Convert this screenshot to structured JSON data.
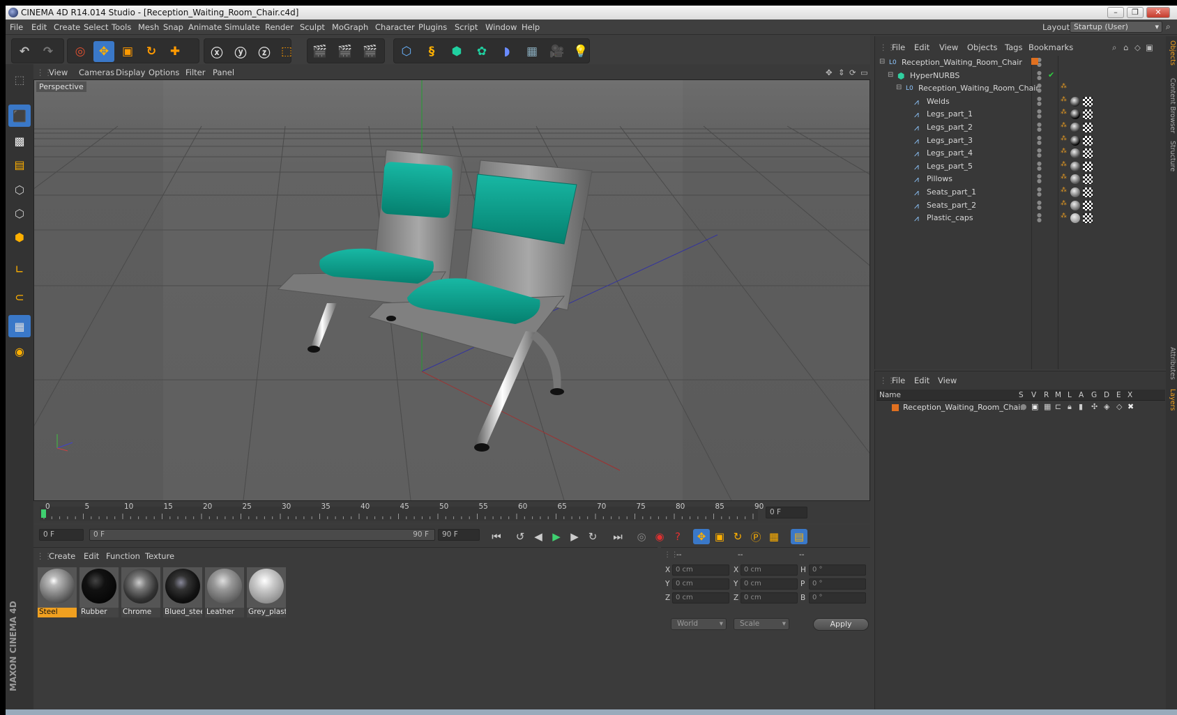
{
  "title": "CINEMA 4D R14.014 Studio - [Reception_Waiting_Room_Chair.c4d]",
  "menus": [
    "File",
    "Edit",
    "Create",
    "Select",
    "Tools",
    "Mesh",
    "Snap",
    "Animate",
    "Simulate",
    "Render",
    "Sculpt",
    "MoGraph",
    "Character",
    "Plugins",
    "Script",
    "Window",
    "Help"
  ],
  "layout": {
    "label": "Layout:",
    "value": "Startup (User)"
  },
  "viewport": {
    "menus": [
      "View",
      "Cameras",
      "Display",
      "Options",
      "Filter",
      "Panel"
    ],
    "label": "Perspective"
  },
  "timeline": {
    "ticks": [
      "0",
      "5",
      "10",
      "15",
      "20",
      "25",
      "30",
      "35",
      "40",
      "45",
      "50",
      "55",
      "60",
      "65",
      "70",
      "75",
      "80",
      "85",
      "90"
    ],
    "current_frame": "0 F",
    "start_field": "0 F",
    "range_start": "0 F",
    "range_end": "90 F",
    "end_field": "90 F"
  },
  "materials": {
    "menus": [
      "Create",
      "Edit",
      "Function",
      "Texture"
    ],
    "items": [
      {
        "name": "Steel",
        "selected": true
      },
      {
        "name": "Rubber"
      },
      {
        "name": "Chrome"
      },
      {
        "name": "Blued_stee"
      },
      {
        "name": "Leather"
      },
      {
        "name": "Grey_plasti"
      }
    ]
  },
  "coordinates": {
    "headers": [
      "--",
      "--",
      "--"
    ],
    "rows": [
      {
        "l1": "X",
        "v1": "0 cm",
        "l2": "X",
        "v2": "0 cm",
        "l3": "H",
        "v3": "0 °"
      },
      {
        "l1": "Y",
        "v1": "0 cm",
        "l2": "Y",
        "v2": "0 cm",
        "l3": "P",
        "v3": "0 °"
      },
      {
        "l1": "Z",
        "v1": "0 cm",
        "l2": "Z",
        "v2": "0 cm",
        "l3": "B",
        "v3": "0 °"
      }
    ],
    "mode1": "World",
    "mode2": "Scale",
    "apply": "Apply"
  },
  "objects": {
    "menus": [
      "File",
      "Edit",
      "View",
      "Objects",
      "Tags",
      "Bookmarks"
    ],
    "items": [
      {
        "name": "Reception_Waiting_Room_Chair",
        "indent": 0,
        "icon": "null-icon"
      },
      {
        "name": "HyperNURBS",
        "indent": 1,
        "icon": "hypernurbs-icon"
      },
      {
        "name": "Reception_Waiting_Room_Chair",
        "indent": 2,
        "icon": "null-icon"
      },
      {
        "name": "Welds",
        "indent": 3,
        "icon": "polygon-object-icon"
      },
      {
        "name": "Legs_part_1",
        "indent": 3,
        "icon": "polygon-object-icon"
      },
      {
        "name": "Legs_part_2",
        "indent": 3,
        "icon": "polygon-object-icon"
      },
      {
        "name": "Legs_part_3",
        "indent": 3,
        "icon": "polygon-object-icon"
      },
      {
        "name": "Legs_part_4",
        "indent": 3,
        "icon": "polygon-object-icon"
      },
      {
        "name": "Legs_part_5",
        "indent": 3,
        "icon": "polygon-object-icon"
      },
      {
        "name": "Pillows",
        "indent": 3,
        "icon": "polygon-object-icon"
      },
      {
        "name": "Seats_part_1",
        "indent": 3,
        "icon": "polygon-object-icon"
      },
      {
        "name": "Seats_part_2",
        "indent": 3,
        "icon": "polygon-object-icon"
      },
      {
        "name": "Plastic_caps",
        "indent": 3,
        "icon": "polygon-object-icon"
      }
    ]
  },
  "layers": {
    "menus": [
      "File",
      "Edit",
      "View"
    ],
    "columns": [
      "Name",
      "S",
      "V",
      "R",
      "M",
      "L",
      "A",
      "G",
      "D",
      "E",
      "X"
    ],
    "items": [
      {
        "name": "Reception_Waiting_Room_Chair",
        "color": "#e07020"
      }
    ]
  },
  "side_tabs": [
    "Objects",
    "Content Browser",
    "Structure",
    "Attributes",
    "Layers"
  ],
  "brand": "MAXON CINEMA 4D",
  "colors": {
    "accent": "#f0a020",
    "seat": "#0fa594",
    "active_tool": "#3a78c8"
  }
}
